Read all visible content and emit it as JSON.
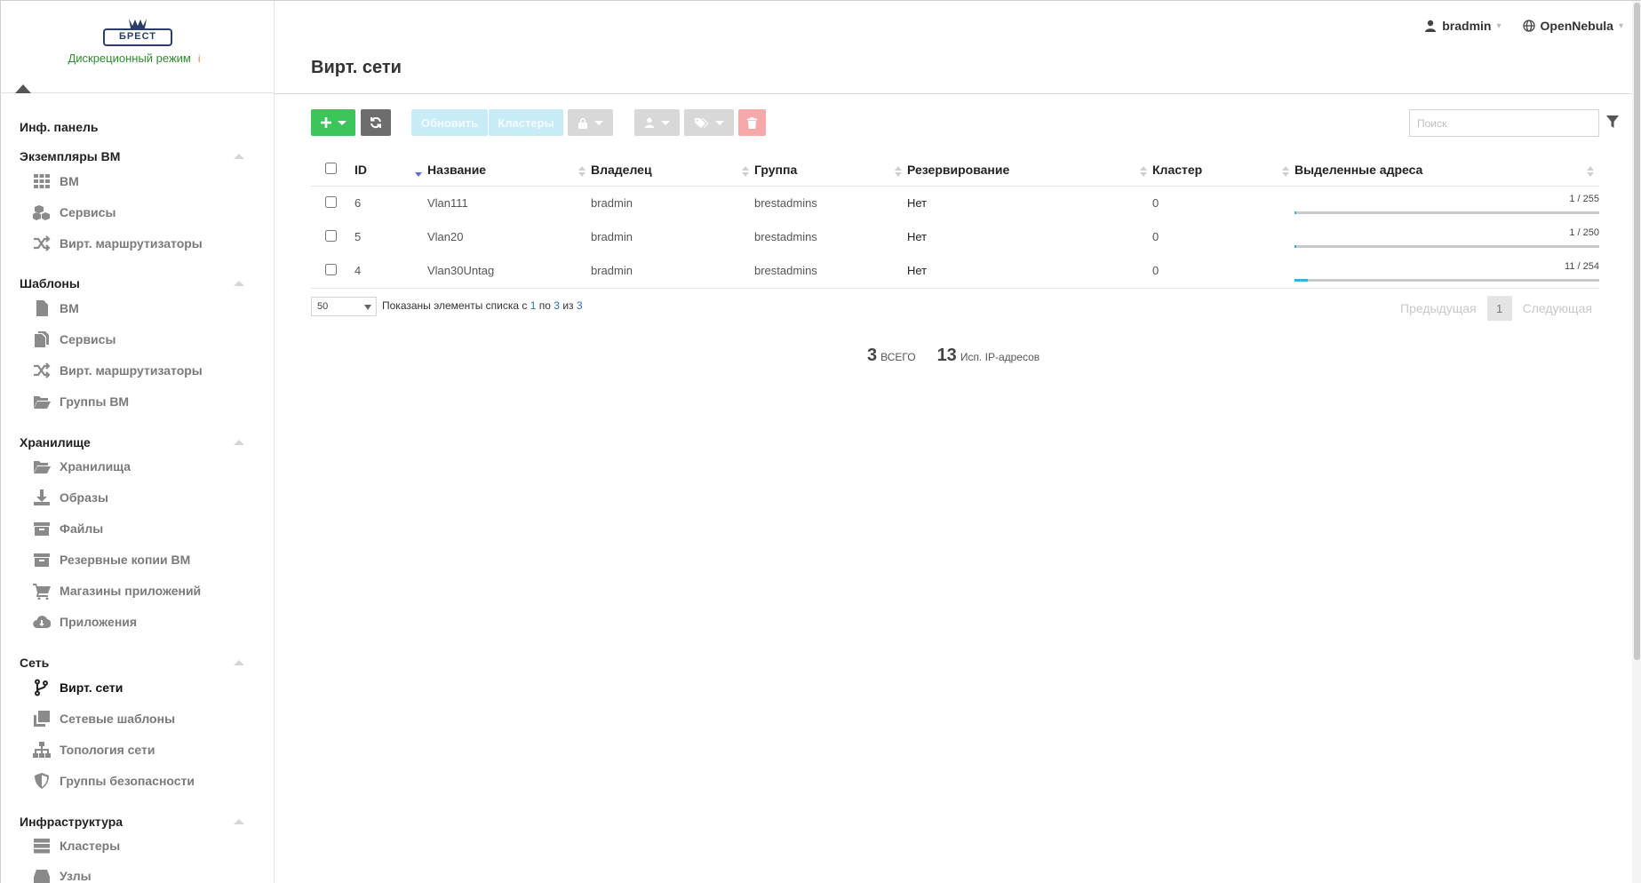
{
  "sidebar": {
    "mode_label": "Дискреционный режим",
    "mode_info": "i",
    "logo_text": "БРЕСТ",
    "dashboard": "Инф. панель",
    "sections": {
      "instances": {
        "title": "Экземпляры ВМ",
        "items": [
          "ВМ",
          "Сервисы",
          "Вирт. маршрутизаторы"
        ]
      },
      "templates": {
        "title": "Шаблоны",
        "items": [
          "ВМ",
          "Сервисы",
          "Вирт. маршрутизаторы",
          "Группы ВМ"
        ]
      },
      "storage": {
        "title": "Хранилище",
        "items": [
          "Хранилища",
          "Образы",
          "Файлы",
          "Резервные копии ВМ",
          "Магазины приложений",
          "Приложения"
        ]
      },
      "network": {
        "title": "Сеть",
        "items": [
          "Вирт. сети",
          "Сетевые шаблоны",
          "Топология сети",
          "Группы безопасности"
        ]
      },
      "infrastructure": {
        "title": "Инфраструктура",
        "items": [
          "Кластеры",
          "Узлы"
        ]
      }
    }
  },
  "header": {
    "user": "bradmin",
    "zone": "OpenNebula"
  },
  "page": {
    "title": "Вирт. сети"
  },
  "toolbar": {
    "update_label": "Обновить",
    "clusters_label": "Кластеры",
    "search_placeholder": "Поиск"
  },
  "table": {
    "columns": [
      "ID",
      "Название",
      "Владелец",
      "Группа",
      "Резервирование",
      "Кластер",
      "Выделенные адреса"
    ],
    "rows": [
      {
        "id": "6",
        "name": "Vlan111",
        "owner": "bradmin",
        "group": "brestadmins",
        "reservation": "Нет",
        "cluster": "0",
        "leases": "1 / 255",
        "leases_used": 1,
        "leases_total": 255
      },
      {
        "id": "5",
        "name": "Vlan20",
        "owner": "bradmin",
        "group": "brestadmins",
        "reservation": "Нет",
        "cluster": "0",
        "leases": "1 / 250",
        "leases_used": 1,
        "leases_total": 250
      },
      {
        "id": "4",
        "name": "Vlan30Untag",
        "owner": "bradmin",
        "group": "brestadmins",
        "reservation": "Нет",
        "cluster": "0",
        "leases": "11 / 254",
        "leases_used": 11,
        "leases_total": 254
      }
    ]
  },
  "footer": {
    "page_length": "50",
    "info_prefix": "Показаны элементы списка с",
    "info_from": "1",
    "info_to_word": "по",
    "info_to": "3",
    "info_of_word": "из",
    "info_total": "3",
    "prev": "Предыдущая",
    "page": "1",
    "next": "Следующая"
  },
  "totals": {
    "total_count": "3",
    "total_label": "ВСЕГО",
    "ip_count": "13",
    "ip_label": "Исп. IP-адресов"
  },
  "colors": {
    "create": "#3dc45a",
    "refresh": "#6d6d6d",
    "lease_fill": "#3ab4d6",
    "mode_green": "#2e8b2e"
  }
}
